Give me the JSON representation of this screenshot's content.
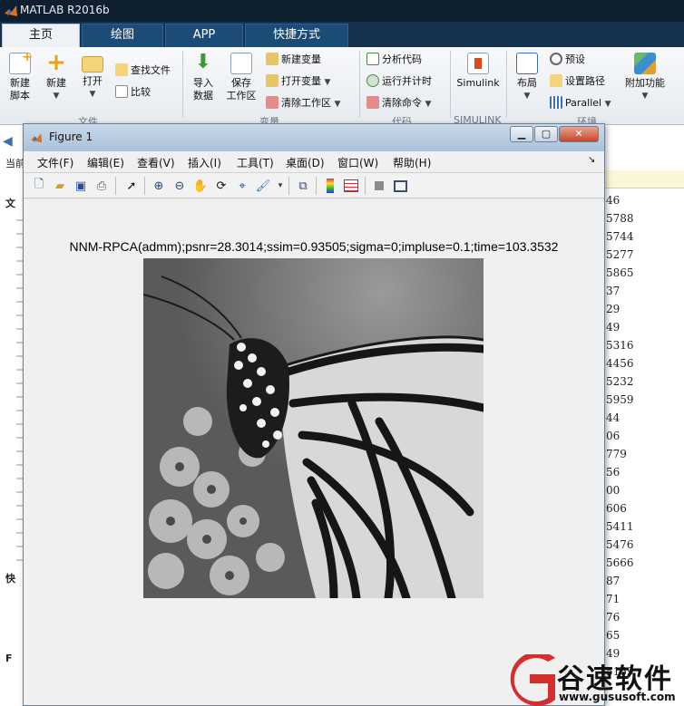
{
  "app": {
    "title": "MATLAB R2016b"
  },
  "tabs": [
    {
      "label": "主页",
      "active": true
    },
    {
      "label": "绘图"
    },
    {
      "label": "APP"
    },
    {
      "label": "快捷方式"
    }
  ],
  "ribbon": {
    "new_script": "新建\n脚本",
    "new": "新建",
    "open": "打开",
    "find_files": "查找文件",
    "compare": "比较",
    "import_data": "导入\n数据",
    "save_workspace": "保存\n工作区",
    "new_variable": "新建变量",
    "open_variable": "打开变量",
    "clear_workspace": "清除工作区",
    "analyze_code": "分析代码",
    "run_and_time": "运行并计时",
    "clear_commands": "清除命令",
    "simulink": "Simulink",
    "layout": "布局",
    "preferences": "预设",
    "set_path": "设置路径",
    "parallel": "Parallel",
    "addons": "附加功能",
    "sections": [
      "文件",
      "变量",
      "代码",
      "SIMULINK",
      "环境"
    ]
  },
  "left_panel": {
    "label_current": "当前",
    "labels": [
      "文",
      "快",
      "F"
    ]
  },
  "right_values": [
    "46",
    "5788",
    "5744",
    "5277",
    "5865",
    "37",
    "29",
    "49",
    "5316",
    "4456",
    "5232",
    "5959",
    "44",
    "06",
    "779",
    "56",
    "00",
    "606",
    "5411",
    "5476",
    "5666",
    "87",
    "71",
    "76",
    "65",
    "49",
    "5169"
  ],
  "figure": {
    "title": "Figure 1",
    "menu": [
      "文件(F)",
      "编辑(E)",
      "查看(V)",
      "插入(I)",
      "工具(T)",
      "桌面(D)",
      "窗口(W)",
      "帮助(H)"
    ],
    "plot_title": "NNM-RPCA(admm);psnr=28.3014;ssim=0.93505;sigma=0;impluse=0.1;time=103.3532"
  },
  "watermark": {
    "brand": "谷速软件",
    "url": "www.gususoft.com"
  },
  "colors": {
    "title_bg": "#0e1f2f",
    "tab_bg": "#15324f",
    "accent": "#1c4b76",
    "watermark_red": "#d32f2f"
  }
}
